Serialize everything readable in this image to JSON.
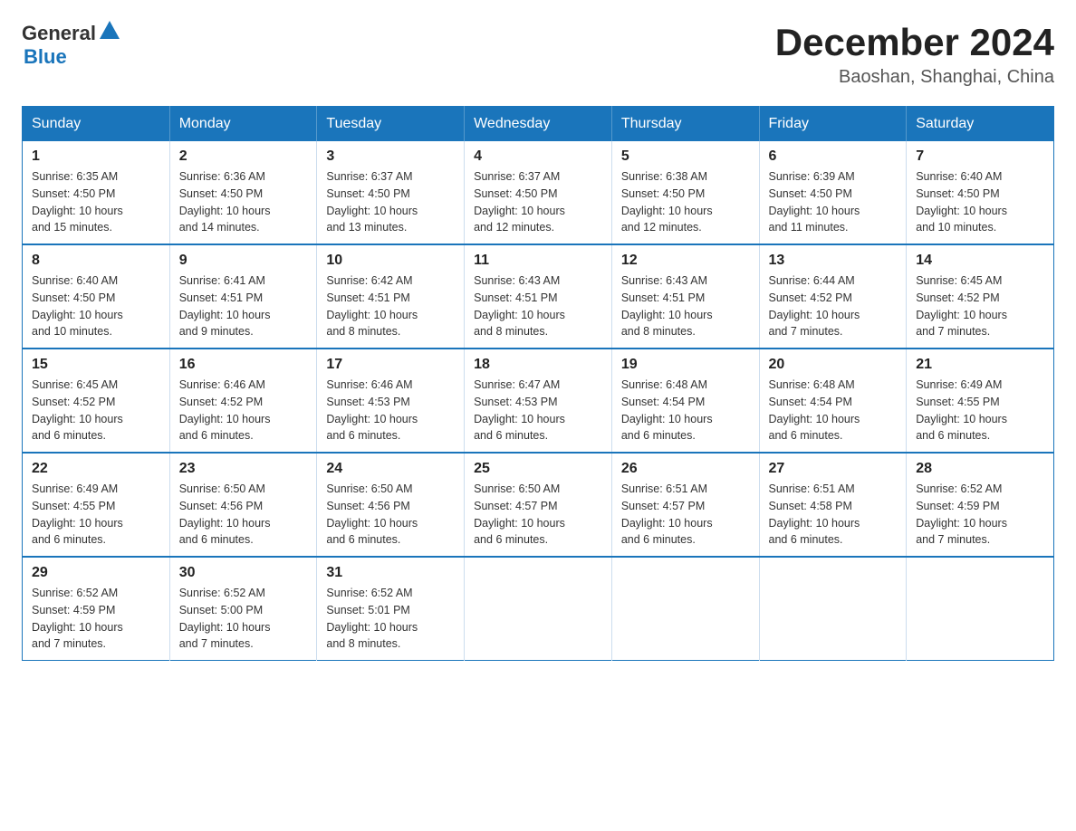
{
  "header": {
    "logo": {
      "general": "General",
      "blue": "Blue"
    },
    "title": "December 2024",
    "location": "Baoshan, Shanghai, China"
  },
  "days_of_week": [
    "Sunday",
    "Monday",
    "Tuesday",
    "Wednesday",
    "Thursday",
    "Friday",
    "Saturday"
  ],
  "weeks": [
    [
      {
        "day": "1",
        "sunrise": "6:35 AM",
        "sunset": "4:50 PM",
        "daylight": "10 hours and 15 minutes."
      },
      {
        "day": "2",
        "sunrise": "6:36 AM",
        "sunset": "4:50 PM",
        "daylight": "10 hours and 14 minutes."
      },
      {
        "day": "3",
        "sunrise": "6:37 AM",
        "sunset": "4:50 PM",
        "daylight": "10 hours and 13 minutes."
      },
      {
        "day": "4",
        "sunrise": "6:37 AM",
        "sunset": "4:50 PM",
        "daylight": "10 hours and 12 minutes."
      },
      {
        "day": "5",
        "sunrise": "6:38 AM",
        "sunset": "4:50 PM",
        "daylight": "10 hours and 12 minutes."
      },
      {
        "day": "6",
        "sunrise": "6:39 AM",
        "sunset": "4:50 PM",
        "daylight": "10 hours and 11 minutes."
      },
      {
        "day": "7",
        "sunrise": "6:40 AM",
        "sunset": "4:50 PM",
        "daylight": "10 hours and 10 minutes."
      }
    ],
    [
      {
        "day": "8",
        "sunrise": "6:40 AM",
        "sunset": "4:50 PM",
        "daylight": "10 hours and 10 minutes."
      },
      {
        "day": "9",
        "sunrise": "6:41 AM",
        "sunset": "4:51 PM",
        "daylight": "10 hours and 9 minutes."
      },
      {
        "day": "10",
        "sunrise": "6:42 AM",
        "sunset": "4:51 PM",
        "daylight": "10 hours and 8 minutes."
      },
      {
        "day": "11",
        "sunrise": "6:43 AM",
        "sunset": "4:51 PM",
        "daylight": "10 hours and 8 minutes."
      },
      {
        "day": "12",
        "sunrise": "6:43 AM",
        "sunset": "4:51 PM",
        "daylight": "10 hours and 8 minutes."
      },
      {
        "day": "13",
        "sunrise": "6:44 AM",
        "sunset": "4:52 PM",
        "daylight": "10 hours and 7 minutes."
      },
      {
        "day": "14",
        "sunrise": "6:45 AM",
        "sunset": "4:52 PM",
        "daylight": "10 hours and 7 minutes."
      }
    ],
    [
      {
        "day": "15",
        "sunrise": "6:45 AM",
        "sunset": "4:52 PM",
        "daylight": "10 hours and 6 minutes."
      },
      {
        "day": "16",
        "sunrise": "6:46 AM",
        "sunset": "4:52 PM",
        "daylight": "10 hours and 6 minutes."
      },
      {
        "day": "17",
        "sunrise": "6:46 AM",
        "sunset": "4:53 PM",
        "daylight": "10 hours and 6 minutes."
      },
      {
        "day": "18",
        "sunrise": "6:47 AM",
        "sunset": "4:53 PM",
        "daylight": "10 hours and 6 minutes."
      },
      {
        "day": "19",
        "sunrise": "6:48 AM",
        "sunset": "4:54 PM",
        "daylight": "10 hours and 6 minutes."
      },
      {
        "day": "20",
        "sunrise": "6:48 AM",
        "sunset": "4:54 PM",
        "daylight": "10 hours and 6 minutes."
      },
      {
        "day": "21",
        "sunrise": "6:49 AM",
        "sunset": "4:55 PM",
        "daylight": "10 hours and 6 minutes."
      }
    ],
    [
      {
        "day": "22",
        "sunrise": "6:49 AM",
        "sunset": "4:55 PM",
        "daylight": "10 hours and 6 minutes."
      },
      {
        "day": "23",
        "sunrise": "6:50 AM",
        "sunset": "4:56 PM",
        "daylight": "10 hours and 6 minutes."
      },
      {
        "day": "24",
        "sunrise": "6:50 AM",
        "sunset": "4:56 PM",
        "daylight": "10 hours and 6 minutes."
      },
      {
        "day": "25",
        "sunrise": "6:50 AM",
        "sunset": "4:57 PM",
        "daylight": "10 hours and 6 minutes."
      },
      {
        "day": "26",
        "sunrise": "6:51 AM",
        "sunset": "4:57 PM",
        "daylight": "10 hours and 6 minutes."
      },
      {
        "day": "27",
        "sunrise": "6:51 AM",
        "sunset": "4:58 PM",
        "daylight": "10 hours and 6 minutes."
      },
      {
        "day": "28",
        "sunrise": "6:52 AM",
        "sunset": "4:59 PM",
        "daylight": "10 hours and 7 minutes."
      }
    ],
    [
      {
        "day": "29",
        "sunrise": "6:52 AM",
        "sunset": "4:59 PM",
        "daylight": "10 hours and 7 minutes."
      },
      {
        "day": "30",
        "sunrise": "6:52 AM",
        "sunset": "5:00 PM",
        "daylight": "10 hours and 7 minutes."
      },
      {
        "day": "31",
        "sunrise": "6:52 AM",
        "sunset": "5:01 PM",
        "daylight": "10 hours and 8 minutes."
      },
      null,
      null,
      null,
      null
    ]
  ],
  "labels": {
    "sunrise": "Sunrise:",
    "sunset": "Sunset:",
    "daylight": "Daylight:"
  }
}
